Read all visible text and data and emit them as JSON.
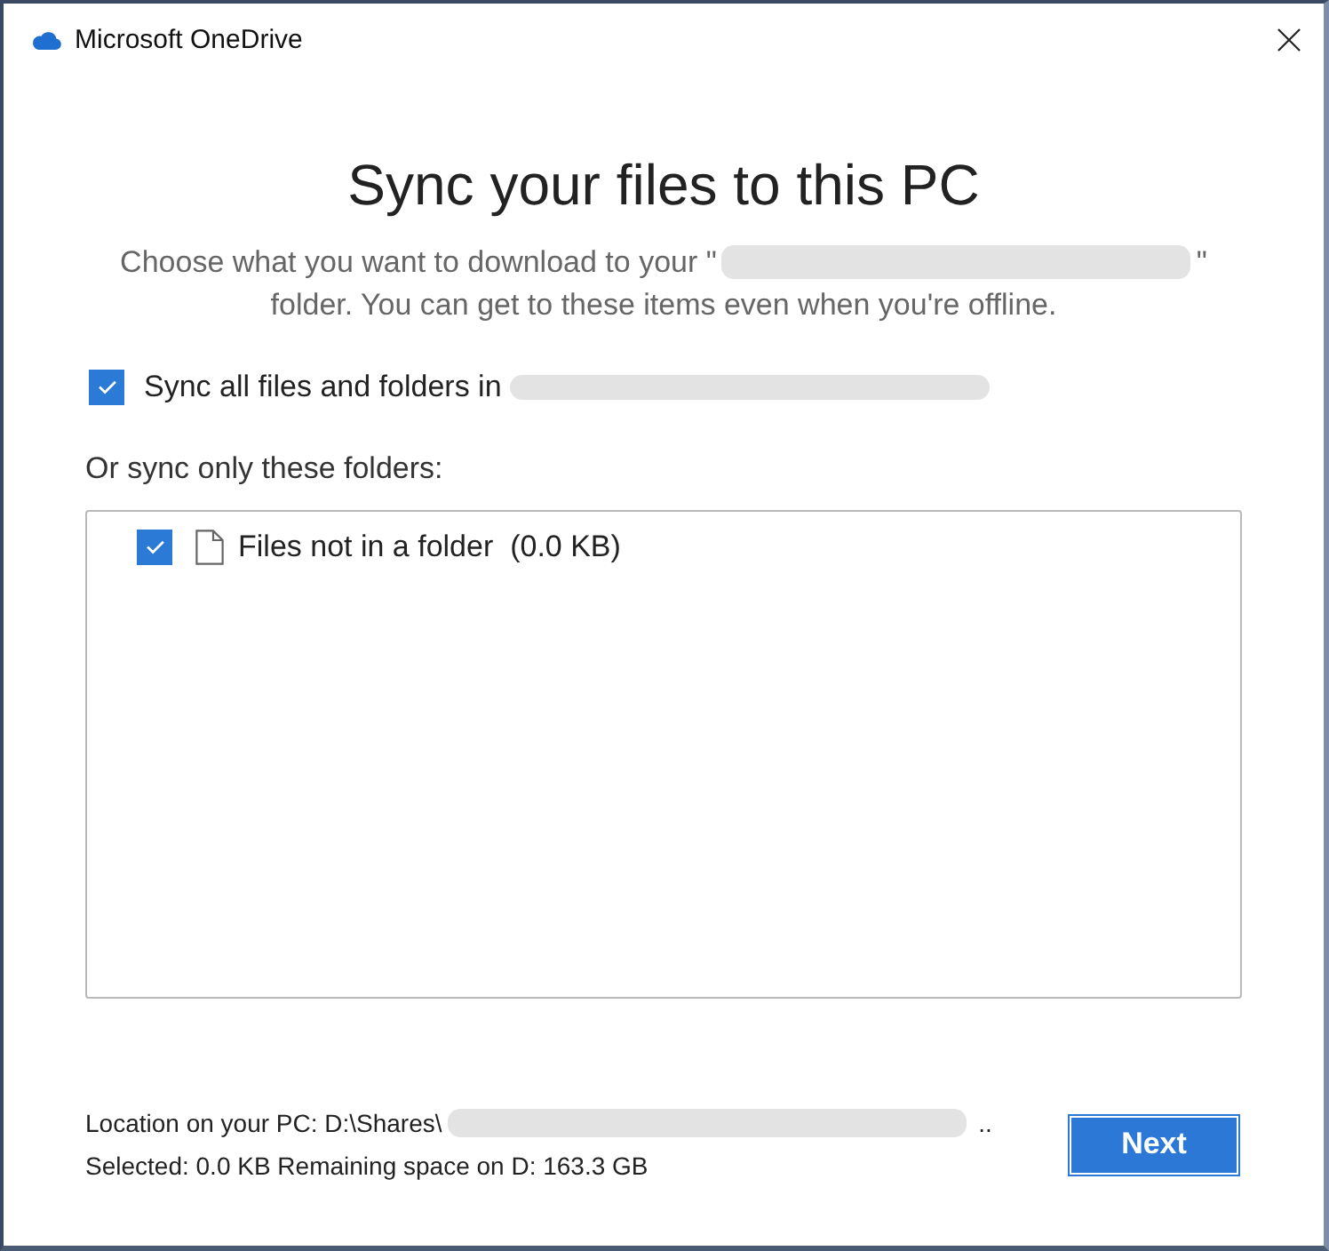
{
  "window": {
    "title": "Microsoft OneDrive"
  },
  "heading": "Sync your files to this PC",
  "description": [
    {
      "kind": "text",
      "text": "Choose what you want to download to your \""
    },
    {
      "kind": "blurred"
    },
    {
      "kind": "text",
      "text": "\" folder. You can get to these items even when you're offline."
    }
  ],
  "sync_all": {
    "checked": true,
    "label": "Sync all files and folders in",
    "blurred_name": true
  },
  "folders_label": "Or sync only these folders:",
  "folders": [
    {
      "kind": "file",
      "label": "Files not in a folder  (0.0 KB)",
      "checked": true
    }
  ],
  "footer": {
    "location": [
      {
        "kind": "text",
        "text": "Location on your PC: D:\\Shares\\"
      },
      {
        "kind": "blurred"
      },
      {
        "kind": "text",
        "text": " .."
      }
    ],
    "selection": "Selected: 0.0 KB Remaining space on D: 163.3 GB",
    "button": "Next"
  }
}
